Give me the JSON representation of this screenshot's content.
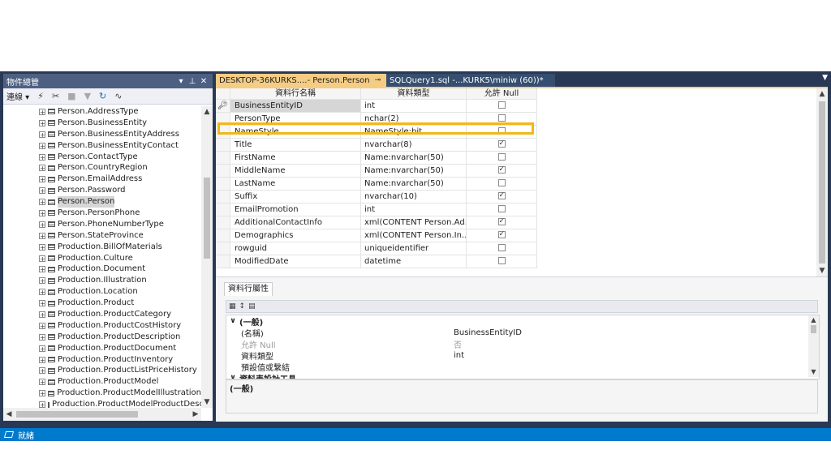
{
  "object_explorer": {
    "title": "物件總管",
    "title_buttons": [
      "▾",
      "⊥",
      "✕"
    ],
    "toolbar": {
      "connect_label": "連線 ▾",
      "icons": [
        "plug-icon",
        "disconnect-icon",
        "stop-icon",
        "filter-icon",
        "refresh-icon",
        "activity-icon"
      ]
    },
    "tree_items": [
      {
        "label": "Person.AddressType",
        "selected": false
      },
      {
        "label": "Person.BusinessEntity",
        "selected": false
      },
      {
        "label": "Person.BusinessEntityAddress",
        "selected": false
      },
      {
        "label": "Person.BusinessEntityContact",
        "selected": false
      },
      {
        "label": "Person.ContactType",
        "selected": false
      },
      {
        "label": "Person.CountryRegion",
        "selected": false
      },
      {
        "label": "Person.EmailAddress",
        "selected": false
      },
      {
        "label": "Person.Password",
        "selected": false
      },
      {
        "label": "Person.Person",
        "selected": true
      },
      {
        "label": "Person.PersonPhone",
        "selected": false
      },
      {
        "label": "Person.PhoneNumberType",
        "selected": false
      },
      {
        "label": "Person.StateProvince",
        "selected": false
      },
      {
        "label": "Production.BillOfMaterials",
        "selected": false
      },
      {
        "label": "Production.Culture",
        "selected": false
      },
      {
        "label": "Production.Document",
        "selected": false
      },
      {
        "label": "Production.Illustration",
        "selected": false
      },
      {
        "label": "Production.Location",
        "selected": false
      },
      {
        "label": "Production.Product",
        "selected": false
      },
      {
        "label": "Production.ProductCategory",
        "selected": false
      },
      {
        "label": "Production.ProductCostHistory",
        "selected": false
      },
      {
        "label": "Production.ProductDescription",
        "selected": false
      },
      {
        "label": "Production.ProductDocument",
        "selected": false
      },
      {
        "label": "Production.ProductInventory",
        "selected": false
      },
      {
        "label": "Production.ProductListPriceHistory",
        "selected": false
      },
      {
        "label": "Production.ProductModel",
        "selected": false
      },
      {
        "label": "Production.ProductModelIllustration",
        "selected": false
      },
      {
        "label": "Production.ProductModelProductDescri",
        "selected": false
      }
    ]
  },
  "tabs": [
    {
      "label": "DESKTOP-36KURKS....- Person.Person",
      "active": true,
      "pin": "⊸",
      "close": "✕"
    },
    {
      "label": "SQLQuery1.sql -...KURK5\\miniw (60))*",
      "active": false
    }
  ],
  "designer": {
    "headers": [
      "資料行名稱",
      "資料類型",
      "允許 Null"
    ],
    "rows": [
      {
        "name": "BusinessEntityID",
        "type": "int",
        "allow_null": false,
        "key": true,
        "selected": true
      },
      {
        "name": "PersonType",
        "type": "nchar(2)",
        "allow_null": false,
        "highlighted": true
      },
      {
        "name": "NameStyle",
        "type": "NameStyle:bit",
        "allow_null": false
      },
      {
        "name": "Title",
        "type": "nvarchar(8)",
        "allow_null": true
      },
      {
        "name": "FirstName",
        "type": "Name:nvarchar(50)",
        "allow_null": false
      },
      {
        "name": "MiddleName",
        "type": "Name:nvarchar(50)",
        "allow_null": true
      },
      {
        "name": "LastName",
        "type": "Name:nvarchar(50)",
        "allow_null": false
      },
      {
        "name": "Suffix",
        "type": "nvarchar(10)",
        "allow_null": true
      },
      {
        "name": "EmailPromotion",
        "type": "int",
        "allow_null": false
      },
      {
        "name": "AdditionalContactInfo",
        "type": "xml(CONTENT Person.Ad...",
        "allow_null": true
      },
      {
        "name": "Demographics",
        "type": "xml(CONTENT Person.In...",
        "allow_null": true
      },
      {
        "name": "rowguid",
        "type": "uniqueidentifier",
        "allow_null": false
      },
      {
        "name": "ModifiedDate",
        "type": "datetime",
        "allow_null": false
      }
    ]
  },
  "column_properties": {
    "tab_label": "資料行屬性",
    "category_general": "(一般)",
    "properties": [
      {
        "name": "(名稱)",
        "value": "BusinessEntityID",
        "dim": false
      },
      {
        "name": "允許 Null",
        "value": "否",
        "dim": true
      },
      {
        "name": "資料類型",
        "value": "int",
        "dim": false
      },
      {
        "name": "預設值或繫結",
        "value": "",
        "dim": false
      }
    ],
    "category_designer": "資料表設計工具",
    "description_title": "(一般)"
  },
  "status_bar": {
    "text": "就緒"
  }
}
